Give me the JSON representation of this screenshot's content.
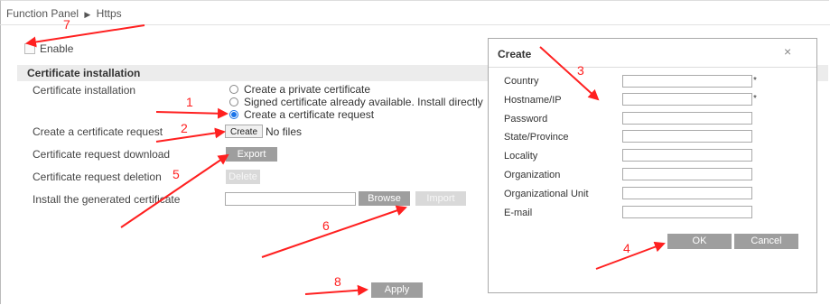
{
  "breadcrumb": {
    "root": "Function Panel",
    "separator": "▶",
    "current": "Https"
  },
  "enable": {
    "label": "Enable",
    "checked": false
  },
  "section": {
    "title": "Certificate installation"
  },
  "rows": {
    "installation": "Certificate installation",
    "request": "Create a certificate request",
    "download": "Certificate request download",
    "deletion": "Certificate request deletion",
    "install_generated": "Install the generated certificate"
  },
  "radios": [
    {
      "label": "Create a private certificate",
      "selected": false
    },
    {
      "label": "Signed certificate already available. Install directly",
      "selected": false
    },
    {
      "label": "Create a certificate request",
      "selected": true
    }
  ],
  "file": {
    "button": "Create",
    "status": "No files"
  },
  "buttons": {
    "export": "Export",
    "delete": "Delete",
    "browse": "Browse",
    "import": "Import",
    "apply": "Apply"
  },
  "dialog": {
    "title": "Create",
    "close": "×",
    "fields": [
      {
        "label": "Country",
        "value": "",
        "required": true
      },
      {
        "label": "Hostname/IP",
        "value": "",
        "required": true
      },
      {
        "label": "Password",
        "value": "",
        "required": false
      },
      {
        "label": "State/Province",
        "value": "",
        "required": false
      },
      {
        "label": "Locality",
        "value": "",
        "required": false
      },
      {
        "label": "Organization",
        "value": "",
        "required": false
      },
      {
        "label": "Organizational Unit",
        "value": "",
        "required": false
      },
      {
        "label": "E-mail",
        "value": "",
        "required": false
      }
    ],
    "required_mark": "*",
    "ok": "OK",
    "cancel": "Cancel"
  },
  "annotations": [
    "1",
    "2",
    "3",
    "4",
    "5",
    "6",
    "7",
    "8"
  ],
  "colors": {
    "annotation": "#ff2020",
    "button_gray": "#9e9e9e",
    "radio_selected": "#1a73e8"
  }
}
